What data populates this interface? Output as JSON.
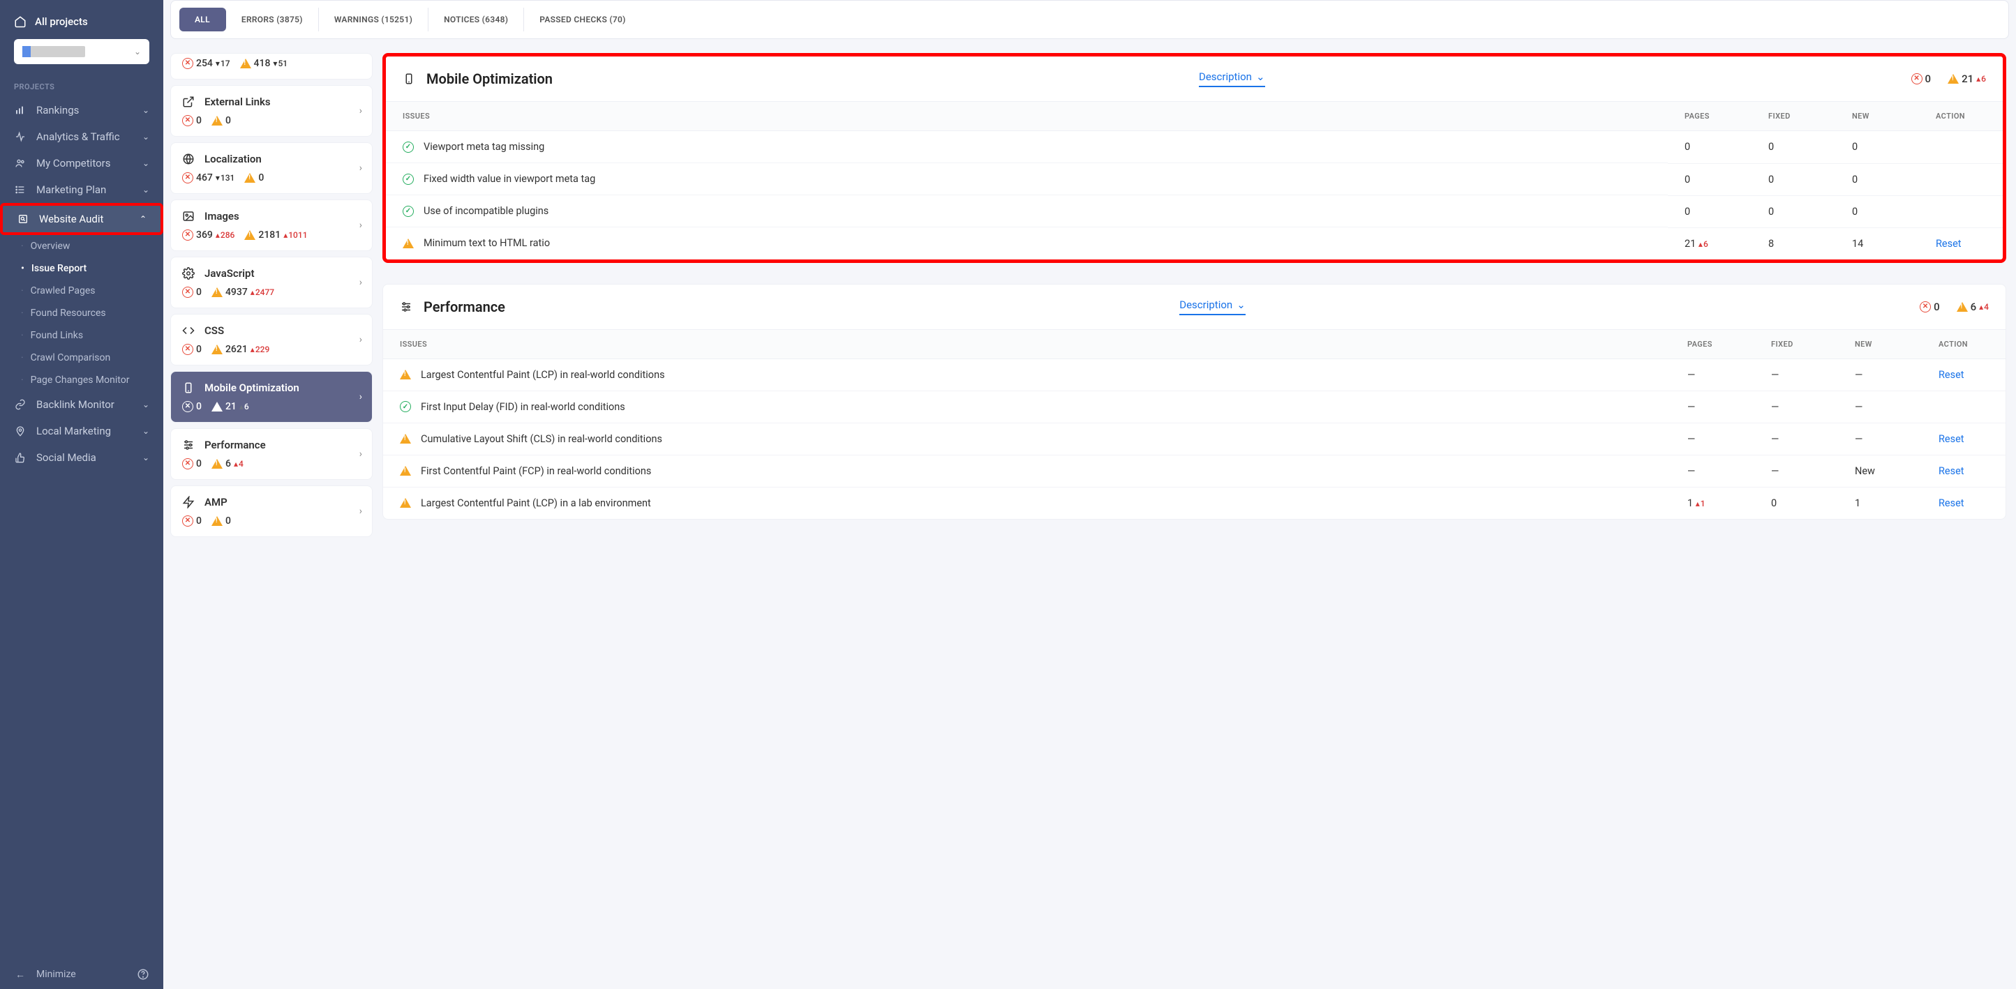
{
  "sidebar": {
    "all_projects": "All projects",
    "section_label": "PROJECTS",
    "items": [
      {
        "label": "Rankings",
        "icon": "bars"
      },
      {
        "label": "Analytics & Traffic",
        "icon": "pulse"
      },
      {
        "label": "My Competitors",
        "icon": "people"
      },
      {
        "label": "Marketing Plan",
        "icon": "list"
      },
      {
        "label": "Website Audit",
        "icon": "audit",
        "active": true
      },
      {
        "label": "Backlink Monitor",
        "icon": "link"
      },
      {
        "label": "Local Marketing",
        "icon": "pin"
      },
      {
        "label": "Social Media",
        "icon": "thumb"
      }
    ],
    "audit_sub": [
      {
        "label": "Overview"
      },
      {
        "label": "Issue Report",
        "active": true
      },
      {
        "label": "Crawled Pages"
      },
      {
        "label": "Found Resources"
      },
      {
        "label": "Found Links"
      },
      {
        "label": "Crawl Comparison"
      },
      {
        "label": "Page Changes Monitor"
      }
    ],
    "minimize": "Minimize"
  },
  "tabs": [
    {
      "label": "ALL",
      "active": true
    },
    {
      "label": "ERRORS (3875)"
    },
    {
      "label": "WARNINGS (15251)"
    },
    {
      "label": "NOTICES (6348)"
    },
    {
      "label": "PASSED CHECKS (70)"
    }
  ],
  "categories": [
    {
      "title_partial": true,
      "errors": "254",
      "err_delta": "17",
      "err_dir": "down",
      "warnings": "418",
      "warn_delta": "51",
      "warn_dir": "down"
    },
    {
      "title": "External Links",
      "icon": "ext",
      "errors": "0",
      "warnings": "0"
    },
    {
      "title": "Localization",
      "icon": "globe",
      "errors": "467",
      "err_delta": "131",
      "err_dir": "down",
      "warnings": "0"
    },
    {
      "title": "Images",
      "icon": "image",
      "errors": "369",
      "err_delta": "286",
      "err_dir": "up",
      "warnings": "2181",
      "warn_delta": "1011",
      "warn_dir": "up"
    },
    {
      "title": "JavaScript",
      "icon": "js",
      "errors": "0",
      "warnings": "4937",
      "warn_delta": "2477",
      "warn_dir": "up"
    },
    {
      "title": "CSS",
      "icon": "css",
      "errors": "0",
      "warnings": "2621",
      "warn_delta": "229",
      "warn_dir": "up"
    },
    {
      "title": "Mobile Optimization",
      "icon": "mobile",
      "selected": true,
      "errors": "0",
      "warnings": "21",
      "warn_delta": "6",
      "warn_dir": "upw"
    },
    {
      "title": "Performance",
      "icon": "sliders",
      "errors": "0",
      "warnings": "6",
      "warn_delta": "4",
      "warn_dir": "up"
    },
    {
      "title": "AMP",
      "icon": "bolt",
      "errors": "0",
      "warnings": "0"
    }
  ],
  "panels": {
    "mobile": {
      "title": "Mobile Optimization",
      "desc_toggle": "Description",
      "errors": "0",
      "warnings": "21",
      "warn_delta": "6",
      "columns": [
        "ISSUES",
        "PAGES",
        "FIXED",
        "NEW",
        "ACTION"
      ],
      "rows": [
        {
          "status": "ok",
          "issue": "Viewport meta tag missing",
          "pages": "0",
          "fixed": "0",
          "new": "0",
          "action": ""
        },
        {
          "status": "ok",
          "issue": "Fixed width value in viewport meta tag",
          "pages": "0",
          "fixed": "0",
          "new": "0",
          "action": ""
        },
        {
          "status": "ok",
          "issue": "Use of incompatible plugins",
          "pages": "0",
          "fixed": "0",
          "new": "0",
          "action": ""
        },
        {
          "status": "warn",
          "issue": "Minimum text to HTML ratio",
          "pages": "21",
          "pages_delta": "6",
          "fixed": "8",
          "new": "14",
          "action": "Reset"
        }
      ]
    },
    "performance": {
      "title": "Performance",
      "desc_toggle": "Description",
      "errors": "0",
      "warnings": "6",
      "warn_delta": "4",
      "columns": [
        "ISSUES",
        "PAGES",
        "FIXED",
        "NEW",
        "ACTION"
      ],
      "rows": [
        {
          "status": "warn",
          "issue": "Largest Contentful Paint (LCP) in real-world conditions",
          "pages": "—",
          "fixed": "—",
          "new": "—",
          "action": "Reset"
        },
        {
          "status": "ok",
          "issue": "First Input Delay (FID) in real-world conditions",
          "pages": "—",
          "fixed": "—",
          "new": "—",
          "action": ""
        },
        {
          "status": "warn",
          "issue": "Cumulative Layout Shift (CLS) in real-world conditions",
          "pages": "—",
          "fixed": "—",
          "new": "—",
          "action": "Reset"
        },
        {
          "status": "warn",
          "issue": "First Contentful Paint (FCP) in real-world conditions",
          "pages": "—",
          "fixed": "—",
          "new": "New",
          "new_badge": true,
          "action": "Reset"
        },
        {
          "status": "warn",
          "issue": "Largest Contentful Paint (LCP) in a lab environment",
          "pages": "1",
          "pages_delta": "1",
          "fixed": "0",
          "new": "1",
          "action": "Reset"
        }
      ]
    }
  }
}
